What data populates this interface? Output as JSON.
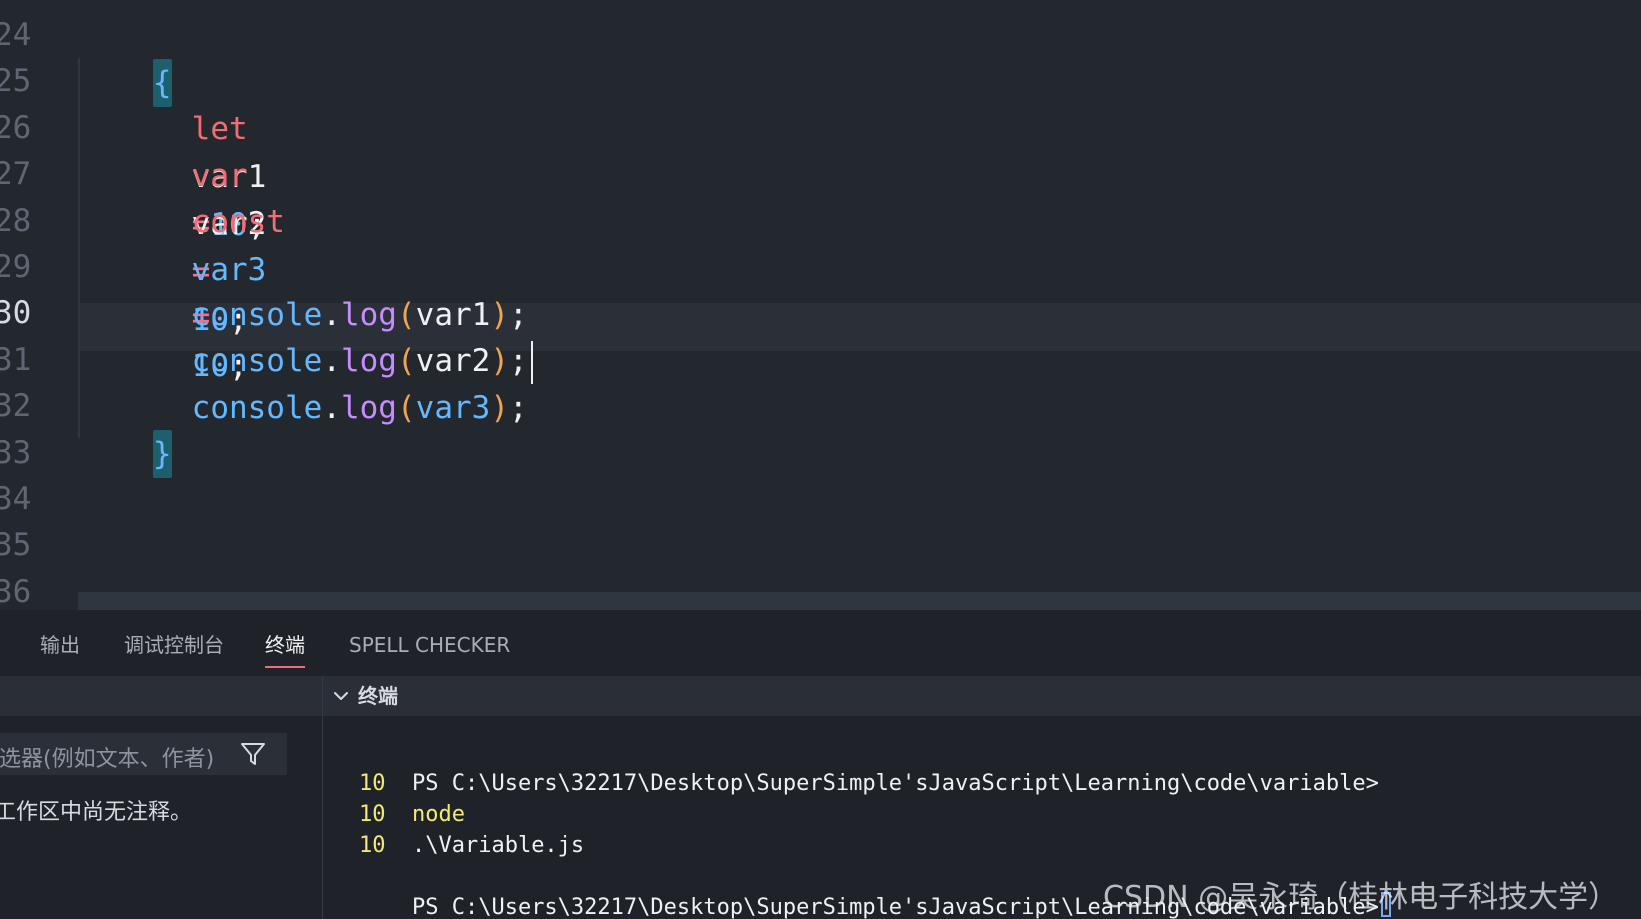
{
  "editor": {
    "line_numbers": [
      "24",
      "25",
      "26",
      "27",
      "28",
      "29",
      "30",
      "31",
      "32",
      "33",
      "34",
      "35",
      "36"
    ],
    "active_line": "30",
    "code": {
      "open_brace": "{",
      "line25": {
        "keyword": "let",
        "name": "var1",
        "operator": "=",
        "value": "10",
        "semicolon": ";"
      },
      "line26": {
        "keyword": "var",
        "name": "var2",
        "operator": "=",
        "value": "10",
        "semicolon": ";"
      },
      "line27": {
        "keyword": "const",
        "name": "var3",
        "operator": "=",
        "value": "10",
        "semicolon": ";"
      },
      "log_object": "console",
      "dot": ".",
      "log_method": "log",
      "open_paren": "(",
      "close_paren": ")",
      "args": [
        "var1",
        "var2",
        "var3"
      ],
      "semicolon": ";",
      "close_brace": "}"
    }
  },
  "panel": {
    "tabs": [
      "输出",
      "调试控制台",
      "终端",
      "SPELL CHECKER"
    ],
    "active_tab": "终端"
  },
  "comments": {
    "filter_placeholder": "选器(例如文本、作者)",
    "empty_message": "工作区中尚无注释。",
    "filter_icon": "filter-icon"
  },
  "terminal": {
    "title": "终端",
    "prompt": "PS C:\\Users\\32217\\Desktop\\SuperSimple'sJavaScript\\Learning\\code\\variable>",
    "command": "node",
    "argument": ".\\Variable.js",
    "outputs": [
      "10",
      "10",
      "10"
    ],
    "final_prompt": "PS C:\\Users\\32217\\Desktop\\SuperSimple'sJavaScript\\Learning\\code\\variable>"
  },
  "watermark": {
    "text": "CSDN @吴永琦（桂林电子科技大学）"
  },
  "colors": {
    "editor_background": "#23272e",
    "active_line": "#2b3038",
    "keyword": "#f36b73",
    "number": "#63b8ff",
    "method": "#c68bff",
    "terminal_output": "#f3ea6f"
  }
}
